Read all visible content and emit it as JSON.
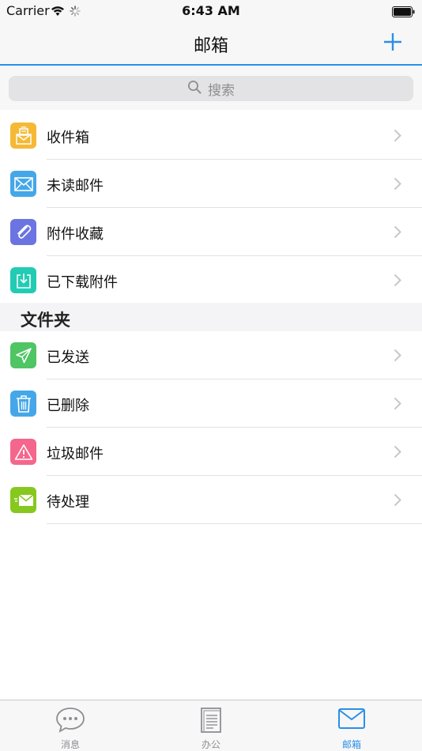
{
  "status_bar": {
    "carrier": "Carrier",
    "time": "6:43 AM"
  },
  "nav": {
    "title": "邮箱",
    "add_icon": "plus-icon"
  },
  "search": {
    "placeholder": "搜索"
  },
  "mailboxes": [
    {
      "label": "收件箱",
      "icon": "inbox-icon",
      "color": "#f5b935"
    },
    {
      "label": "未读邮件",
      "icon": "envelope-icon",
      "color": "#45a7e8"
    },
    {
      "label": "附件收藏",
      "icon": "paperclip-icon",
      "color": "#6b74e0"
    },
    {
      "label": "已下载附件",
      "icon": "download-icon",
      "color": "#22ccb4"
    }
  ],
  "folders_section": {
    "title": "文件夹"
  },
  "folders": [
    {
      "label": "已发送",
      "icon": "paper-plane-icon",
      "color": "#4fc564"
    },
    {
      "label": "已删除",
      "icon": "trash-icon",
      "color": "#45a7e8"
    },
    {
      "label": "垃圾邮件",
      "icon": "warning-icon",
      "color": "#f5668c"
    },
    {
      "label": "待处理",
      "icon": "pending-mail-icon",
      "color": "#86c81e"
    }
  ],
  "tabs": [
    {
      "label": "消息",
      "icon": "chat-bubble-icon",
      "active": false
    },
    {
      "label": "办公",
      "icon": "document-icon",
      "active": false
    },
    {
      "label": "邮箱",
      "icon": "mail-icon",
      "active": true
    }
  ],
  "colors": {
    "accent": "#2a8fe8",
    "inactive_tab": "#8e8e93"
  }
}
